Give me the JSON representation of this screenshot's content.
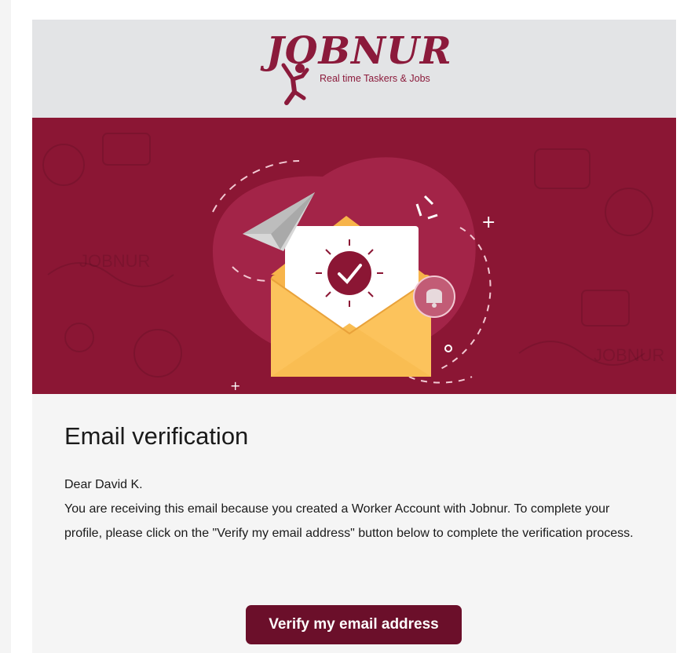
{
  "brand": {
    "name": "JOBNUR",
    "tagline": "Real time Taskers & Jobs",
    "color": "#8b1a3b"
  },
  "hero": {
    "background_color": "#8b1634",
    "pattern_text": "JOBNUR",
    "illustration": "envelope-with-checkmark-icon"
  },
  "email": {
    "title": "Email verification",
    "greeting": "Dear David K.",
    "body": "You are receiving this email because you created a Worker Account with Jobnur. To complete your profile, please click on the \"Verify my email address\" button below to complete the verification process.",
    "button_label": "Verify my email address",
    "button_color": "#6b0f2a"
  }
}
